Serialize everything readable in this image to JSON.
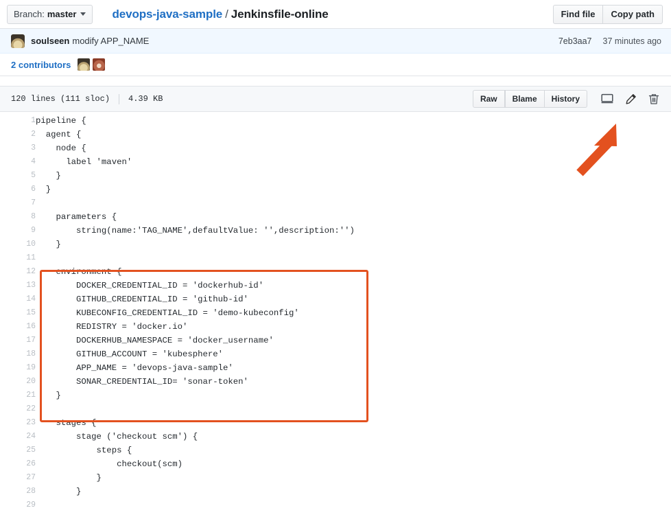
{
  "colors": {
    "accent_blue": "#1f6fc4",
    "annotation_orange": "#e3511f",
    "commit_bar_bg": "#f1f8ff",
    "file_header_bg": "#f6f8fa",
    "border": "#e1e4e8"
  },
  "topbar": {
    "branch_prefix": "Branch:",
    "branch_name": "master",
    "repo_name": "devops-java-sample",
    "path_separator": "/",
    "file_name": "Jenkinsfile-online",
    "find_file_label": "Find file",
    "copy_path_label": "Copy path"
  },
  "commit": {
    "author": "soulseen",
    "message": "modify APP_NAME",
    "sha": "7eb3aa7",
    "time": "37 minutes ago"
  },
  "contributors": {
    "label": "2 contributors",
    "count": 2
  },
  "file_header": {
    "lines": "120 lines (111 sloc)",
    "size": "4.39 KB",
    "raw_label": "Raw",
    "blame_label": "Blame",
    "history_label": "History",
    "icons": [
      {
        "name": "desktop-icon",
        "title": "Open this file in GitHub Desktop"
      },
      {
        "name": "pencil-icon",
        "title": "Edit this file"
      },
      {
        "name": "trash-icon",
        "title": "Delete this file"
      }
    ]
  },
  "annotations": {
    "arrow": {
      "name": "pointer-arrow",
      "color": "#e3511f",
      "points_to": "pencil-icon"
    },
    "highlight_box": {
      "name": "environment-block-highlight",
      "color": "#e3511f",
      "covers_lines": "12-21"
    }
  },
  "code": {
    "language": "groovy",
    "lines": [
      {
        "n": 1,
        "t": "pipeline {"
      },
      {
        "n": 2,
        "t": "  agent {"
      },
      {
        "n": 3,
        "t": "    node {"
      },
      {
        "n": 4,
        "t": "      label 'maven'"
      },
      {
        "n": 5,
        "t": "    }"
      },
      {
        "n": 6,
        "t": "  }"
      },
      {
        "n": 7,
        "t": ""
      },
      {
        "n": 8,
        "t": "    parameters {"
      },
      {
        "n": 9,
        "t": "        string(name:'TAG_NAME',defaultValue: '',description:'')"
      },
      {
        "n": 10,
        "t": "    }"
      },
      {
        "n": 11,
        "t": ""
      },
      {
        "n": 12,
        "t": "    environment {"
      },
      {
        "n": 13,
        "t": "        DOCKER_CREDENTIAL_ID = 'dockerhub-id'"
      },
      {
        "n": 14,
        "t": "        GITHUB_CREDENTIAL_ID = 'github-id'"
      },
      {
        "n": 15,
        "t": "        KUBECONFIG_CREDENTIAL_ID = 'demo-kubeconfig'"
      },
      {
        "n": 16,
        "t": "        REDISTRY = 'docker.io'"
      },
      {
        "n": 17,
        "t": "        DOCKERHUB_NAMESPACE = 'docker_username'"
      },
      {
        "n": 18,
        "t": "        GITHUB_ACCOUNT = 'kubesphere'"
      },
      {
        "n": 19,
        "t": "        APP_NAME = 'devops-java-sample'"
      },
      {
        "n": 20,
        "t": "        SONAR_CREDENTIAL_ID= 'sonar-token'"
      },
      {
        "n": 21,
        "t": "    }"
      },
      {
        "n": 22,
        "t": ""
      },
      {
        "n": 23,
        "t": "    stages {"
      },
      {
        "n": 24,
        "t": "        stage ('checkout scm') {"
      },
      {
        "n": 25,
        "t": "            steps {"
      },
      {
        "n": 26,
        "t": "                checkout(scm)"
      },
      {
        "n": 27,
        "t": "            }"
      },
      {
        "n": 28,
        "t": "        }"
      },
      {
        "n": 29,
        "t": ""
      }
    ]
  }
}
